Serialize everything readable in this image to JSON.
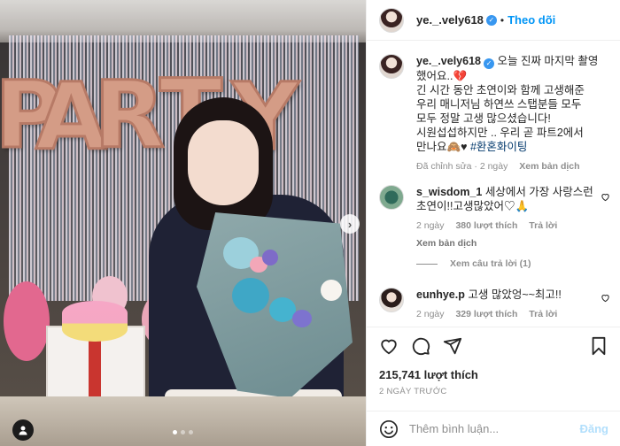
{
  "header": {
    "username": "ye._.vely618",
    "follow_label": "Theo dõi",
    "separator": "•",
    "verified_glyph": "✓"
  },
  "caption": {
    "username": "ye._.vely618",
    "text_lines": [
      "오늘 진짜 마지막 촬영",
      "했어요..💔",
      "긴 시간 동안 초연이와 함께 고생해준",
      "우리 매니저님 하연쓰 스탭분들 모두",
      "모두 정말 고생 많으셨습니다!",
      "시원섭섭하지만 .. 우리 곧 파트2에서",
      "만나요🙈♥ "
    ],
    "hashtag": "#환혼화이팅",
    "edited_label": "Đã chỉnh sửa",
    "time": "2 ngày",
    "translate_label": "Xem bản dịch"
  },
  "comments": [
    {
      "username": "s_wisdom_1",
      "text_line1": "세상에서 가장 사랑스런",
      "text_line2": "초연이!!고생많았어♡🙏",
      "time": "2 ngày",
      "likes": "380 lượt thích",
      "reply_label": "Trả lời",
      "translate_label": "Xem bản dịch",
      "view_replies_label": "Xem câu trả lời (1)"
    },
    {
      "username": "eunhye.p",
      "text": "고생 많았엉~~최고!!",
      "time": "2 ngày",
      "likes": "329 lượt thích",
      "reply_label": "Trả lời"
    }
  ],
  "actions": {
    "likes_count": "215,741 lượt thích",
    "posted_ago": "2 NGÀY TRƯỚC"
  },
  "add_comment": {
    "placeholder": "Thêm bình luận...",
    "post_label": "Đăng"
  },
  "carousel": {
    "next_glyph": "›",
    "slide_count": 3,
    "current_slide": 1
  },
  "photo": {
    "balloon_letters": [
      "P",
      "A",
      "R",
      "T",
      "Y"
    ]
  },
  "colors": {
    "accent": "#0095f6",
    "verified": "#3897f0",
    "post_disabled": "#b2dffc",
    "hashtag": "#00376b"
  }
}
